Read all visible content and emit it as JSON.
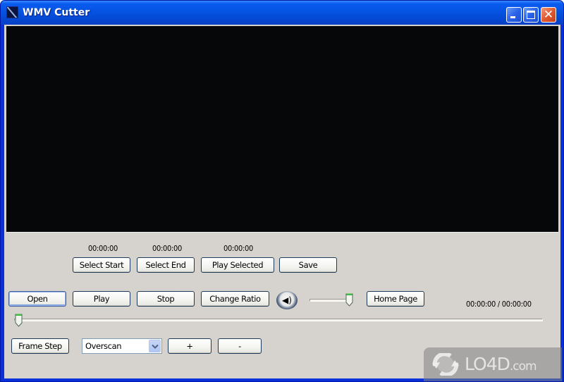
{
  "window": {
    "title": "WMV Cutter",
    "controls": {
      "minimize": "minimize",
      "maximize": "maximize",
      "close": "close"
    }
  },
  "selection": {
    "start_time": "00:00:00",
    "end_time": "00:00:00",
    "play_selected_time": "00:00:00",
    "buttons": {
      "select_start": "Select Start",
      "select_end": "Select End",
      "play_selected": "Play Selected",
      "save": "Save"
    }
  },
  "playback": {
    "buttons": {
      "open": "Open",
      "play": "Play",
      "stop": "Stop",
      "change_ratio": "Change Ratio",
      "home_page": "Home Page"
    },
    "volume_icon": "speaker-icon",
    "volume_level": 1.0,
    "position_fraction": 0.0,
    "time_display": "00:00:00 / 00:00:00"
  },
  "frame": {
    "frame_step_label": "Frame Step",
    "zoom_mode": {
      "selected": "Overscan"
    },
    "plus_label": "+",
    "minus_label": "-"
  },
  "watermark": {
    "text": "LO4D",
    "suffix": ".com"
  }
}
